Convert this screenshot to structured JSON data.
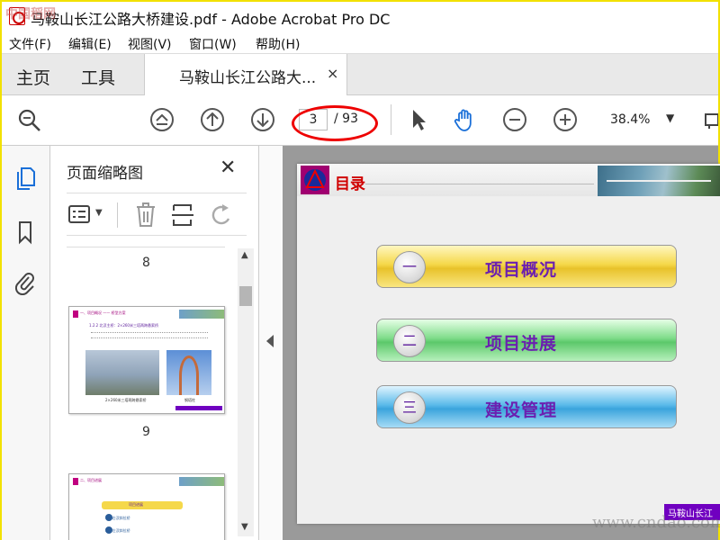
{
  "window": {
    "title": "马鞍山长江公路大桥建设.pdf - Adobe Acrobat Pro DC"
  },
  "menu": [
    "文件(F)",
    "编辑(E)",
    "视图(V)",
    "窗口(W)",
    "帮助(H)"
  ],
  "tabs": {
    "home": "主页",
    "tools": "工具",
    "doc": "马鞍山长江公路大...",
    "close": "×"
  },
  "toolbar": {
    "current_page": "3",
    "total_pages": "/ 93",
    "zoom": "38.4%"
  },
  "thumbnails_panel": {
    "title": "页面缩略图",
    "close": "✕",
    "page_numbers": [
      "8",
      "9"
    ],
    "thumb9": {
      "heading": "一、项目概况 —— 桥型方案",
      "subheading": "1.2.2 北汊主桥：2×260米三塔两跨悬索桥",
      "caption_left": "2×260米三塔两跨悬索桥",
      "caption_right": "钢塔柱"
    },
    "thumb10": {
      "heading": "二、项目进展",
      "item1": "项目进展",
      "item2": "2.1  右汊斜拉桥",
      "item3": "2.2  左汊斜拉桥"
    }
  },
  "document": {
    "slide_title": "目录",
    "items": [
      {
        "num": "一",
        "label": "项目概况"
      },
      {
        "num": "二",
        "label": "项目进展"
      },
      {
        "num": "三",
        "label": "建设管理"
      }
    ],
    "footer_tag": "马鞍山长江"
  },
  "watermarks": {
    "top": "中国稻网",
    "bottom": "www.cndao.com"
  },
  "colors": {
    "accent_red": "#e00000",
    "purple_text": "#6b1fb0",
    "yellow_bar": "#f5d84a",
    "green_bar": "#7fdc8a",
    "blue_bar": "#5cbbea"
  }
}
